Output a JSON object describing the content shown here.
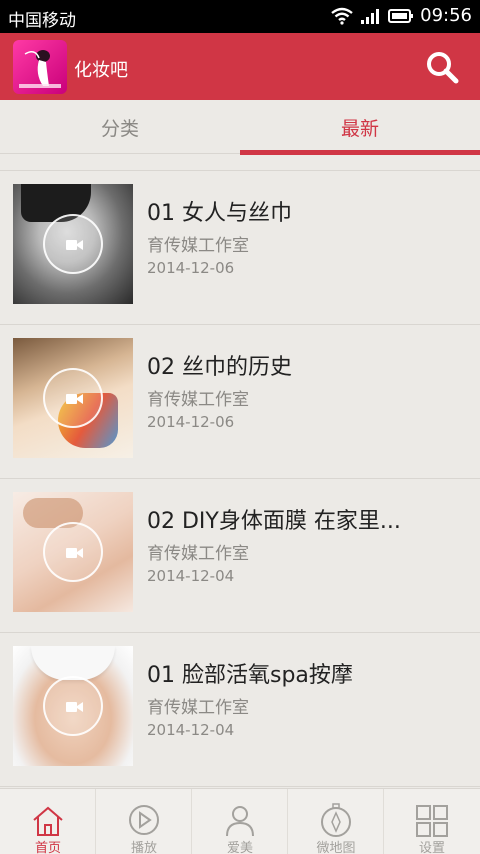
{
  "status_bar": {
    "carrier": "中国移动",
    "time": "09:56"
  },
  "header": {
    "app_name": "化妆吧",
    "accent_color": "#d03645",
    "search_icon": "search-icon"
  },
  "tabs": [
    {
      "label": "分类",
      "active": false
    },
    {
      "label": "最新",
      "active": true
    }
  ],
  "videos": [
    {
      "title": "01 女人与丝巾",
      "author": "育传媒工作室",
      "date": "2014-12-06"
    },
    {
      "title": "02 丝巾的历史",
      "author": "育传媒工作室",
      "date": "2014-12-06"
    },
    {
      "title": "02 DIY身体面膜 在家里...",
      "author": "育传媒工作室",
      "date": "2014-12-04"
    },
    {
      "title": "01 脸部活氧spa按摩",
      "author": "育传媒工作室",
      "date": "2014-12-04"
    }
  ],
  "bottom_nav": [
    {
      "label": "首页",
      "icon": "home-icon",
      "active": true
    },
    {
      "label": "播放",
      "icon": "play-icon",
      "active": false
    },
    {
      "label": "爱美",
      "icon": "person-icon",
      "active": false
    },
    {
      "label": "微地图",
      "icon": "compass-icon",
      "active": false
    },
    {
      "label": "设置",
      "icon": "grid-icon",
      "active": false
    }
  ]
}
